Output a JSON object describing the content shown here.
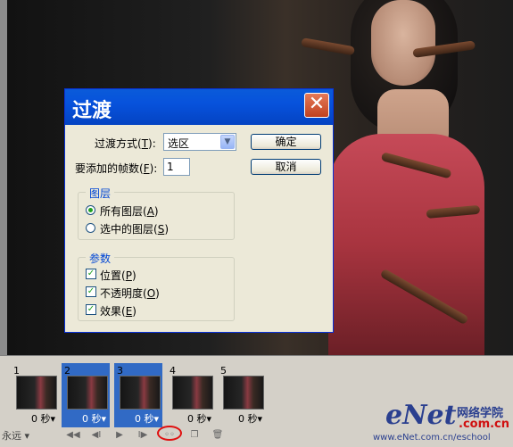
{
  "dialog": {
    "title": "过渡",
    "close_glyph": "✕",
    "method_label_pre": "过渡方式(",
    "method_label_key": "T",
    "method_label_post": "):",
    "method_value": "选区",
    "frames_label_pre": "要添加的帧数(",
    "frames_label_key": "F",
    "frames_label_post": "):",
    "frames_value": "1",
    "ok_label": "确定",
    "cancel_label": "取消",
    "layers_group": {
      "title": "图层",
      "all_pre": "所有图层(",
      "all_key": "A",
      "all_post": ")",
      "selected_pre": "选中的图层(",
      "selected_key": "S",
      "selected_post": ")"
    },
    "params_group": {
      "title": "参数",
      "position_pre": "位置(",
      "position_key": "P",
      "position_post": ")",
      "opacity_pre": "不透明度(",
      "opacity_key": "O",
      "opacity_post": ")",
      "effects_pre": "效果(",
      "effects_key": "E",
      "effects_post": ")"
    }
  },
  "animation": {
    "frames": [
      {
        "num": "1",
        "time": "0 秒▾"
      },
      {
        "num": "2",
        "time": "0 秒▾"
      },
      {
        "num": "3",
        "time": "0 秒▾"
      },
      {
        "num": "4",
        "time": "0 秒▾"
      },
      {
        "num": "5",
        "time": "0 秒▾"
      }
    ],
    "loop_value": "永远 ▾",
    "controls": {
      "first": "◀◀",
      "prev": "◀I",
      "play": "▶",
      "next": "I▶",
      "tween": "◦◦",
      "new": "❐",
      "delete": "🗑"
    }
  },
  "watermark": {
    "logo": "eNet",
    "cn": "网络学院",
    "domain": ".com.cn",
    "url": "www.eNet.com.cn/eschool"
  },
  "colors": {
    "accent": "#316ac5",
    "title_bar": "#0752dc",
    "highlight": "#e01010"
  }
}
